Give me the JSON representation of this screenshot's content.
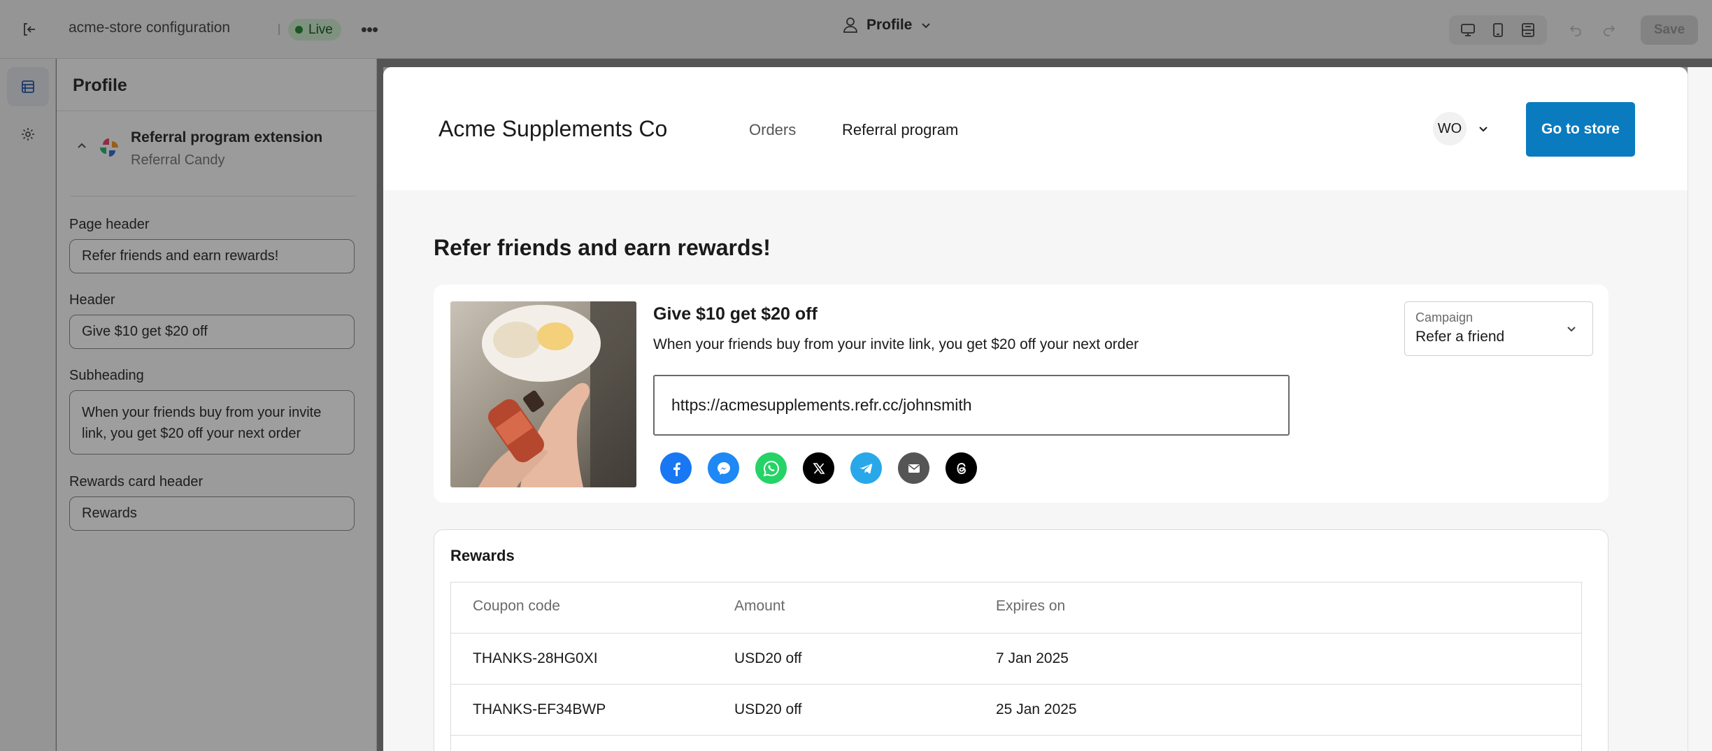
{
  "topbar": {
    "store_name": "acme-store configuration",
    "status": "Live",
    "more_label": "•••",
    "profile_label": "Profile",
    "save_label": "Save"
  },
  "sidebar": {
    "title": "Profile",
    "extension": {
      "title": "Referral program extension",
      "subtitle": "Referral Candy"
    },
    "fields": [
      {
        "label": "Page header",
        "value": "Refer friends and earn rewards!"
      },
      {
        "label": "Header",
        "value": "Give $10 get $20 off"
      },
      {
        "label": "Subheading",
        "value": "When your friends buy from your invite link, you get $20 off your next order"
      },
      {
        "label": "Rewards card header",
        "value": "Rewards"
      }
    ]
  },
  "preview": {
    "brand": "Acme Supplements Co",
    "nav": [
      "Orders",
      "Referral program"
    ],
    "avatar_initials": "WO",
    "go_to_store": "Go to store",
    "page_title": "Refer friends and earn rewards!",
    "offer": {
      "title": "Give $10 get $20 off",
      "subtitle": "When your friends buy from your invite link, you get $20 off your next order",
      "link": "https://acmesupplements.refr.cc/johnsmith",
      "share_icons": [
        "facebook-icon",
        "messenger-icon",
        "whatsapp-icon",
        "x-icon",
        "telegram-icon",
        "email-icon",
        "threads-icon"
      ]
    },
    "campaign": {
      "label": "Campaign",
      "value": "Refer a friend"
    },
    "rewards": {
      "title": "Rewards",
      "columns": [
        "Coupon code",
        "Amount",
        "Expires on"
      ],
      "rows": [
        [
          "THANKS-28HG0XI",
          "USD20 off",
          "7 Jan 2025"
        ],
        [
          "THANKS-EF34BWP",
          "USD20 off",
          "25 Jan 2025"
        ]
      ]
    }
  },
  "colors": {
    "accent": "#0a7bbf",
    "live_badge": "#cdeccf",
    "facebook": "#1877f2",
    "messenger": "#1e88f5",
    "whatsapp": "#25d366",
    "telegram": "#28a8e9"
  }
}
